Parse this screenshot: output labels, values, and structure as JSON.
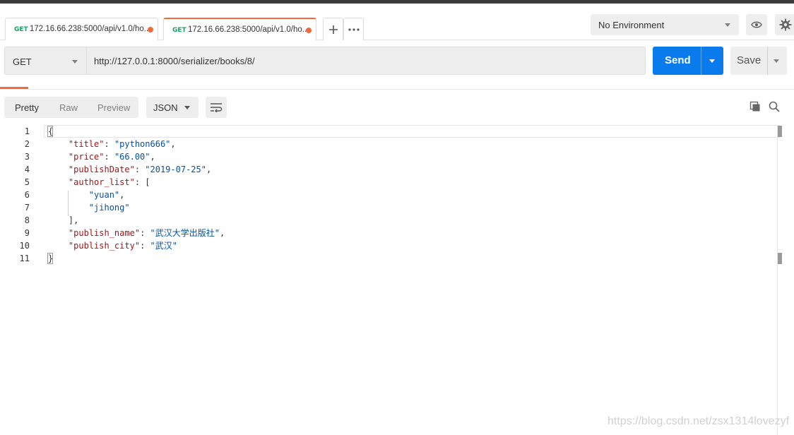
{
  "tabs": [
    {
      "method": "GET",
      "url": "172.16.66.238:5000/api/v1.0/ho...",
      "active": false
    },
    {
      "method": "GET",
      "url": "172.16.66.238:5000/api/v1.0/ho...",
      "active": true
    }
  ],
  "tab_actions": {
    "add_icon": "plus-icon",
    "more_icon": "more-dots-icon"
  },
  "environment": {
    "selected": "No Environment",
    "eye_icon": "eye-icon",
    "settings_icon": "gear-icon"
  },
  "request": {
    "method": "GET",
    "url": "http://127.0.0.1:8000/serializer/books/8/",
    "send_label": "Send",
    "save_label": "Save"
  },
  "response": {
    "view_tabs": [
      "Pretty",
      "Raw",
      "Preview"
    ],
    "active_view": "Pretty",
    "format": "JSON",
    "wrap_icon": "wrap-lines-icon",
    "copy_icon": "copy-icon",
    "search_icon": "search-icon",
    "lines": [
      {
        "n": "1",
        "parts": [
          {
            "t": "{",
            "c": "p"
          }
        ]
      },
      {
        "n": "2",
        "parts": [
          {
            "t": "    ",
            "c": "p"
          },
          {
            "t": "\"title\"",
            "c": "k"
          },
          {
            "t": ": ",
            "c": "p"
          },
          {
            "t": "\"python666\"",
            "c": "s"
          },
          {
            "t": ",",
            "c": "p"
          }
        ]
      },
      {
        "n": "3",
        "parts": [
          {
            "t": "    ",
            "c": "p"
          },
          {
            "t": "\"price\"",
            "c": "k"
          },
          {
            "t": ": ",
            "c": "p"
          },
          {
            "t": "\"66.00\"",
            "c": "s"
          },
          {
            "t": ",",
            "c": "p"
          }
        ]
      },
      {
        "n": "4",
        "parts": [
          {
            "t": "    ",
            "c": "p"
          },
          {
            "t": "\"publishDate\"",
            "c": "k"
          },
          {
            "t": ": ",
            "c": "p"
          },
          {
            "t": "\"2019-07-25\"",
            "c": "s"
          },
          {
            "t": ",",
            "c": "p"
          }
        ]
      },
      {
        "n": "5",
        "parts": [
          {
            "t": "    ",
            "c": "p"
          },
          {
            "t": "\"author_list\"",
            "c": "k"
          },
          {
            "t": ": [",
            "c": "p"
          }
        ]
      },
      {
        "n": "6",
        "parts": [
          {
            "t": "        ",
            "c": "p"
          },
          {
            "t": "\"yuan\"",
            "c": "s"
          },
          {
            "t": ",",
            "c": "p"
          }
        ]
      },
      {
        "n": "7",
        "parts": [
          {
            "t": "        ",
            "c": "p"
          },
          {
            "t": "\"jihong\"",
            "c": "s"
          }
        ]
      },
      {
        "n": "8",
        "parts": [
          {
            "t": "    ],",
            "c": "p"
          }
        ]
      },
      {
        "n": "9",
        "parts": [
          {
            "t": "    ",
            "c": "p"
          },
          {
            "t": "\"publish_name\"",
            "c": "k"
          },
          {
            "t": ": ",
            "c": "p"
          },
          {
            "t": "\"武汉大学出版社\"",
            "c": "s"
          },
          {
            "t": ",",
            "c": "p"
          }
        ]
      },
      {
        "n": "10",
        "parts": [
          {
            "t": "    ",
            "c": "p"
          },
          {
            "t": "\"publish_city\"",
            "c": "k"
          },
          {
            "t": ": ",
            "c": "p"
          },
          {
            "t": "\"武汉\"",
            "c": "s"
          }
        ]
      },
      {
        "n": "11",
        "parts": [
          {
            "t": "}",
            "c": "p"
          }
        ]
      }
    ]
  },
  "watermark": "https://blog.csdn.net/zsx1314lovezyf",
  "colors": {
    "accent": "#f26b3a",
    "send": "#097bed",
    "get_method": "#18a05e",
    "key": "#a31515",
    "string": "#0451a5"
  }
}
